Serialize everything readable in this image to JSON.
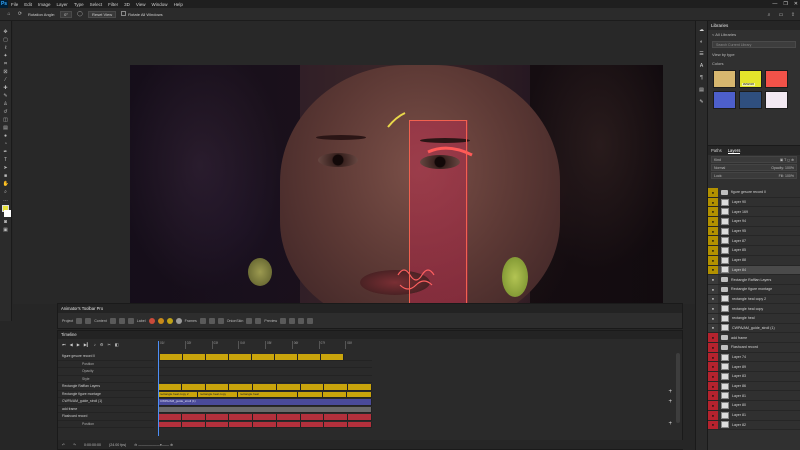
{
  "menu": {
    "logo": "Ps",
    "items": [
      "File",
      "Edit",
      "Image",
      "Layer",
      "Type",
      "Select",
      "Filter",
      "3D",
      "View",
      "Window",
      "Help"
    ],
    "window_controls": [
      "—",
      "❐",
      "✕"
    ]
  },
  "options_bar": {
    "rotation_label": "Rotation Angle:",
    "rotation_value": "0°",
    "reset_label": "Reset View",
    "rotate_all_label": "Rotate All Windows"
  },
  "libraries": {
    "title": "Libraries",
    "back_label": "< All Libraries",
    "search_placeholder": "Search Current Library",
    "view_by": "View by type",
    "colors_label": "Colors",
    "swatches": [
      {
        "color": "#d7b76f",
        "label": ""
      },
      {
        "color": "#e4e52b",
        "label": "#E5E52B"
      },
      {
        "color": "#f25249",
        "label": ""
      },
      {
        "color": "#4d5fcb",
        "label": ""
      },
      {
        "color": "#2f4f7f",
        "label": ""
      },
      {
        "color": "#f2e9f2",
        "label": ""
      }
    ]
  },
  "layers_panel": {
    "tabs": [
      "Paths",
      "Layers"
    ],
    "active_tab": "Layers",
    "kind": "Kind",
    "blend": "Normal",
    "opacity": "Opacity: 100%",
    "lock": "Lock:",
    "fill": "Fill: 100%",
    "rows": [
      {
        "name": "figure gesure record ll",
        "eye": "ye",
        "type": "folder"
      },
      {
        "name": "Layer 90",
        "eye": "ye",
        "type": "layer"
      },
      {
        "name": "Layer 169",
        "eye": "ye",
        "type": "layer"
      },
      {
        "name": "Layer 94",
        "eye": "ye",
        "type": "layer"
      },
      {
        "name": "Layer 95",
        "eye": "ye",
        "type": "layer"
      },
      {
        "name": "Layer 87",
        "eye": "ye",
        "type": "layer"
      },
      {
        "name": "Layer 85",
        "eye": "ye",
        "type": "layer"
      },
      {
        "name": "Layer 88",
        "eye": "ye",
        "type": "layer"
      },
      {
        "name": "Layer 84",
        "eye": "ye",
        "type": "layer",
        "selected": true
      },
      {
        "name": "Rectangle Rafflan Layers",
        "eye": "ne",
        "type": "folder"
      },
      {
        "name": "Rectangle figure montage",
        "eye": "ne",
        "type": "folder"
      },
      {
        "name": "rectangle heal copy 2",
        "eye": "ne",
        "type": "layer"
      },
      {
        "name": "rectangle heal copy",
        "eye": "ne",
        "type": "layer"
      },
      {
        "name": "rectangle heal",
        "eye": "ne",
        "type": "layer"
      },
      {
        "name": "CWPA/AM_guide_stroll (1)",
        "eye": "ne",
        "type": "layer"
      },
      {
        "name": "add frame",
        "eye": "re",
        "type": "folder"
      },
      {
        "name": "Flashcard record",
        "eye": "re",
        "type": "folder"
      },
      {
        "name": "Layer 74",
        "eye": "re",
        "type": "layer"
      },
      {
        "name": "Layer 89",
        "eye": "re",
        "type": "layer"
      },
      {
        "name": "Layer 83",
        "eye": "re",
        "type": "layer"
      },
      {
        "name": "Layer 86",
        "eye": "re",
        "type": "layer"
      },
      {
        "name": "Layer 81",
        "eye": "re",
        "type": "layer"
      },
      {
        "name": "Layer 80",
        "eye": "re",
        "type": "layer"
      },
      {
        "name": "Layer 81",
        "eye": "re",
        "type": "layer"
      },
      {
        "name": "Layer 82",
        "eye": "re",
        "type": "layer"
      }
    ]
  },
  "animators_toolbar": {
    "title": "Animator's Toolbar Pro",
    "project_label": "Project",
    "content_label": "Content",
    "label_label": "Label",
    "frames_label": "Frames",
    "onion_label": "OnionSkin",
    "preview_label": "Preview",
    "label_colors": [
      "#c94a3a",
      "#c88a1a",
      "#c0a217",
      "#9a9a9a"
    ]
  },
  "timeline": {
    "title": "Timeline",
    "ruler": [
      "01f",
      "02f",
      "03f",
      "04f",
      "05f",
      "06f",
      "07f",
      "08f"
    ],
    "tracks": [
      {
        "name": "figure gesure record ll",
        "sub": false
      },
      {
        "name": "Position",
        "sub": true
      },
      {
        "name": "Opacity",
        "sub": true
      },
      {
        "name": "Style",
        "sub": true
      },
      {
        "name": "Rectangle Rafflan Layers",
        "sub": false
      },
      {
        "name": "Rectangle figure montage",
        "sub": false
      },
      {
        "name": "CWPA/AM_guide_stroll (1)",
        "sub": false
      },
      {
        "name": "add frame",
        "sub": false
      },
      {
        "name": "Flashcard record",
        "sub": false
      },
      {
        "name": "Position",
        "sub": true
      }
    ],
    "clip_labels": {
      "rect_copy2": "rectangle heal copy 2",
      "rect_copy": "rectangle heal copy",
      "rect": "rectangle heal",
      "guide": "CWPA/AM_guide_stroll (1)"
    },
    "footer": {
      "time": "0:00:00:00",
      "fps": "(24.00 fps)"
    }
  }
}
